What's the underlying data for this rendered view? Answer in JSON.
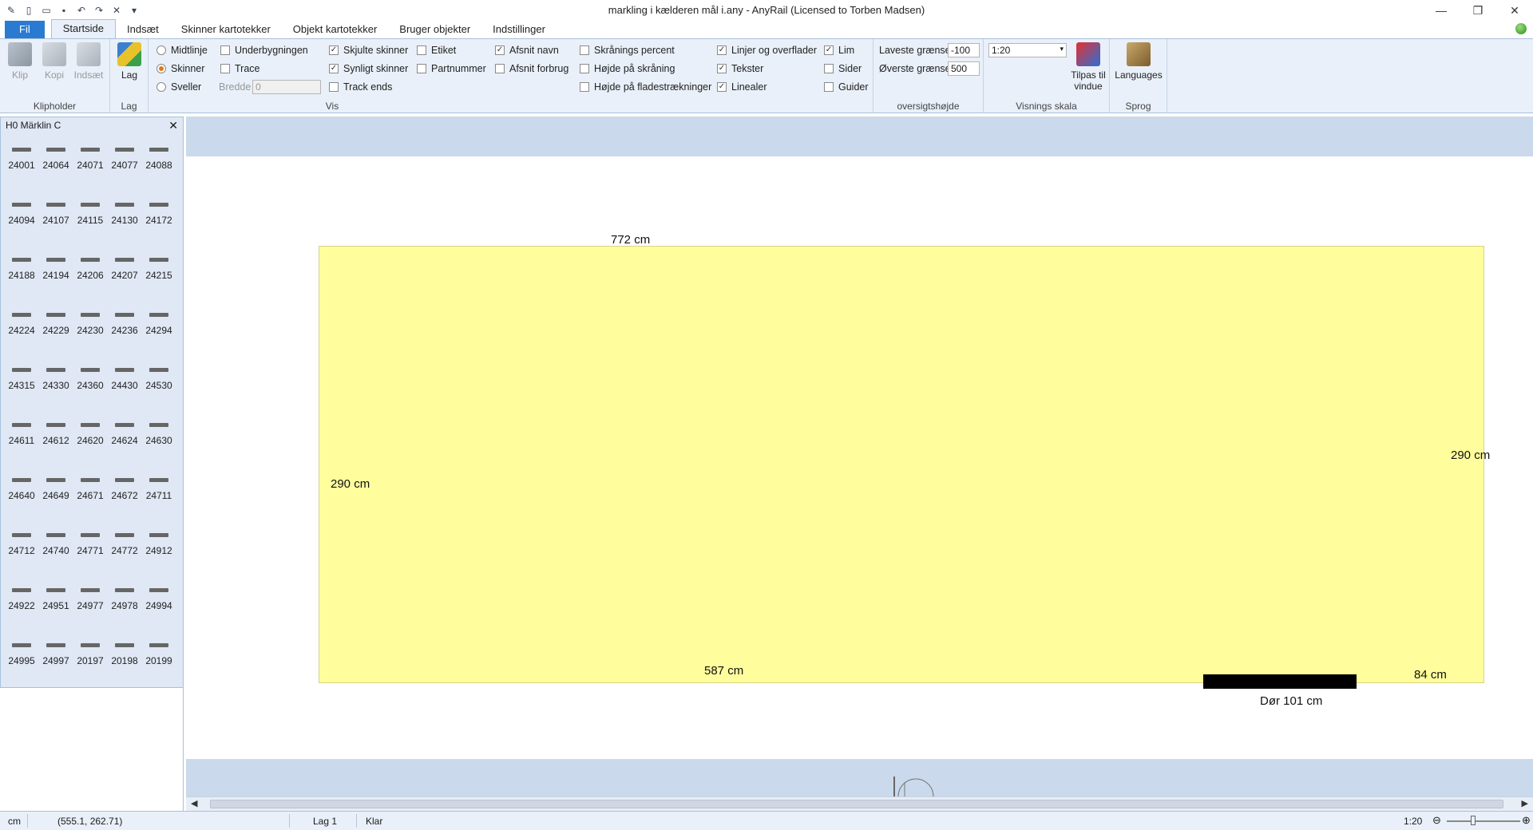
{
  "window": {
    "title": "markling i kælderen mål i.any - AnyRail (Licensed to Torben Madsen)",
    "controls": {
      "minimize": "—",
      "restore": "❐",
      "close": "✕"
    }
  },
  "tabs": [
    "Fil",
    "Startside",
    "Indsæt",
    "Skinner kartotekker",
    "Objekt kartotekker",
    "Bruger objekter",
    "Indstillinger"
  ],
  "active_tab": "Startside",
  "ribbon": {
    "clipboard": {
      "cut": "Klip",
      "copy": "Kopi",
      "paste": "Indsæt",
      "label": "Klipholder"
    },
    "layer": {
      "button": "Lag",
      "label": "Lag"
    },
    "view": {
      "label": "Vis",
      "radios": {
        "midtlinje": "Midtlinje",
        "skinner": "Skinner",
        "sveller": "Sveller"
      },
      "underbygningen": "Underbygningen",
      "trace": "Trace",
      "bredde_label": "Bredde",
      "bredde_value": "0",
      "skjulte_skinner": "Skjulte skinner",
      "synligt_skinner": "Synligt skinner",
      "track_ends": "Track ends",
      "etiket": "Etiket",
      "partnummer": "Partnummer",
      "afsnit_navn": "Afsnit navn",
      "afsnit_forbrug": "Afsnit forbrug",
      "skraanings_percent": "Skrånings percent",
      "hojde_paa_skraaning": "Højde på skråning",
      "hojde_paa_flade": "Højde på fladestrækninger",
      "linjer_og_overflader": "Linjer og overflader",
      "tekster": "Tekster",
      "linealer": "Linealer",
      "lim": "Lim",
      "sider": "Sider",
      "guider": "Guider"
    },
    "overview_height": {
      "label": "oversigtshøjde",
      "lowest_label": "Laveste grænse",
      "lowest_value": "-100",
      "highest_label": "Øverste grænse",
      "highest_value": "500"
    },
    "view_scale": {
      "label": "Visnings skala",
      "value": "1:20",
      "fit_button": "Tilpas til vindue"
    },
    "language": {
      "button": "Languages",
      "label": "Sprog"
    }
  },
  "panel": {
    "title": "H0 Märklin C",
    "parts": [
      "24001",
      "24064",
      "24071",
      "24077",
      "24088",
      "24094",
      "24107",
      "24115",
      "24130",
      "24172",
      "24188",
      "24194",
      "24206",
      "24207",
      "24215",
      "24224",
      "24229",
      "24230",
      "24236",
      "24294",
      "24315",
      "24330",
      "24360",
      "24430",
      "24530",
      "24611",
      "24612",
      "24620",
      "24624",
      "24630",
      "24640",
      "24649",
      "24671",
      "24672",
      "24711",
      "24712",
      "24740",
      "24771",
      "24772",
      "24912",
      "24922",
      "24951",
      "24977",
      "24978",
      "24994",
      "24995",
      "24997",
      "20197",
      "20198",
      "20199"
    ]
  },
  "canvas": {
    "dims": {
      "top": "772 cm",
      "left": "290 cm",
      "right": "290 cm",
      "bottom": "587 cm",
      "bottom_right": "84 cm",
      "door": "Dør 101 cm"
    },
    "room_color": "#fffd9c"
  },
  "status": {
    "unit": "cm",
    "coords": "(555.1, 262.71)",
    "layer": "Lag 1",
    "state": "Klar",
    "zoom": "1:20"
  }
}
